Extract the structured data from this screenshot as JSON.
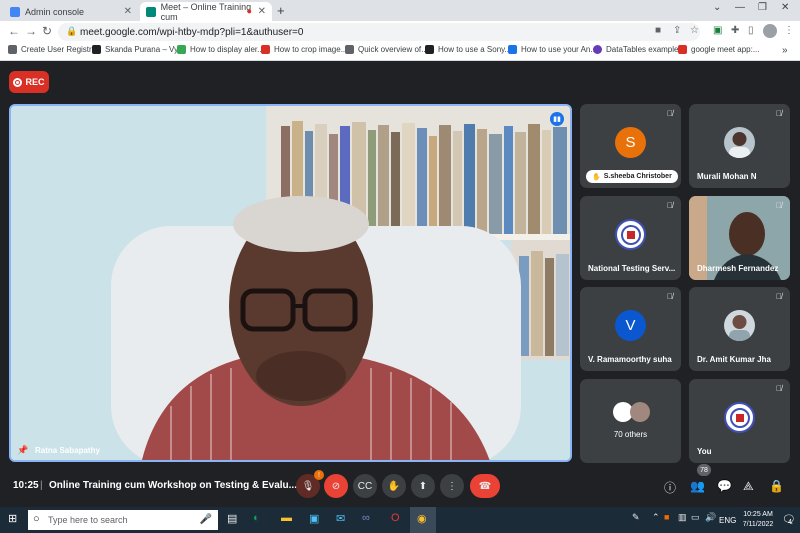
{
  "browser": {
    "tabs": [
      {
        "title": "Admin console",
        "active": false,
        "color": "#4285f4"
      },
      {
        "title": "Meet – Online Training cum",
        "active": true,
        "color": "#00897b"
      }
    ],
    "new_tab": "+",
    "url": "meet.google.com/wpi-htby-mdp?pli=1&authuser=0",
    "bookmarks": [
      {
        "label": "Create User Registr...",
        "icon_color": "#5f6368"
      },
      {
        "label": "Skanda Purana – Vy...",
        "icon_color": "#202124"
      },
      {
        "label": "How to display aler...",
        "icon_color": "#34a853"
      },
      {
        "label": "How to crop image...",
        "icon_color": "#d93025"
      },
      {
        "label": "Quick overview of...",
        "icon_color": "#5f6368"
      },
      {
        "label": "How to use a Sony...",
        "icon_color": "#202124"
      },
      {
        "label": "How to use your An...",
        "icon_color": "#1a73e8"
      },
      {
        "label": "DataTables example...",
        "icon_color": "#673ab7"
      },
      {
        "label": "google meet app:...",
        "icon_color": "#d93025"
      }
    ],
    "bookmarks_more": "»"
  },
  "meet": {
    "rec_label": "REC",
    "main_speaker": "Ratna Sabapathy",
    "participants": [
      {
        "name": "S.sheeba Christober",
        "initial": "S",
        "avatar_color": "#e8710a",
        "kind": "initial-pill"
      },
      {
        "name": "Murali Mohan N",
        "kind": "photo"
      },
      {
        "name": "National Testing Serv...",
        "kind": "logo"
      },
      {
        "name": "Dharmesh Fernandez",
        "kind": "video"
      },
      {
        "name": "V. Ramamoorthy suha",
        "initial": "V",
        "avatar_color": "#0b57d0",
        "kind": "initial"
      },
      {
        "name": "Dr. Amit Kumar Jha",
        "kind": "photo"
      },
      {
        "name": "70 others",
        "kind": "others"
      },
      {
        "name": "You",
        "kind": "logo"
      }
    ],
    "time": "10:25",
    "meeting_title": "Online Training cum Workshop on Testing & Evalu...",
    "participant_count": "78"
  },
  "taskbar": {
    "search_placeholder": "Type here to search",
    "language": "ENG",
    "clock_time": "10:25 AM",
    "clock_date": "7/11/2022",
    "notification_count": "4"
  }
}
